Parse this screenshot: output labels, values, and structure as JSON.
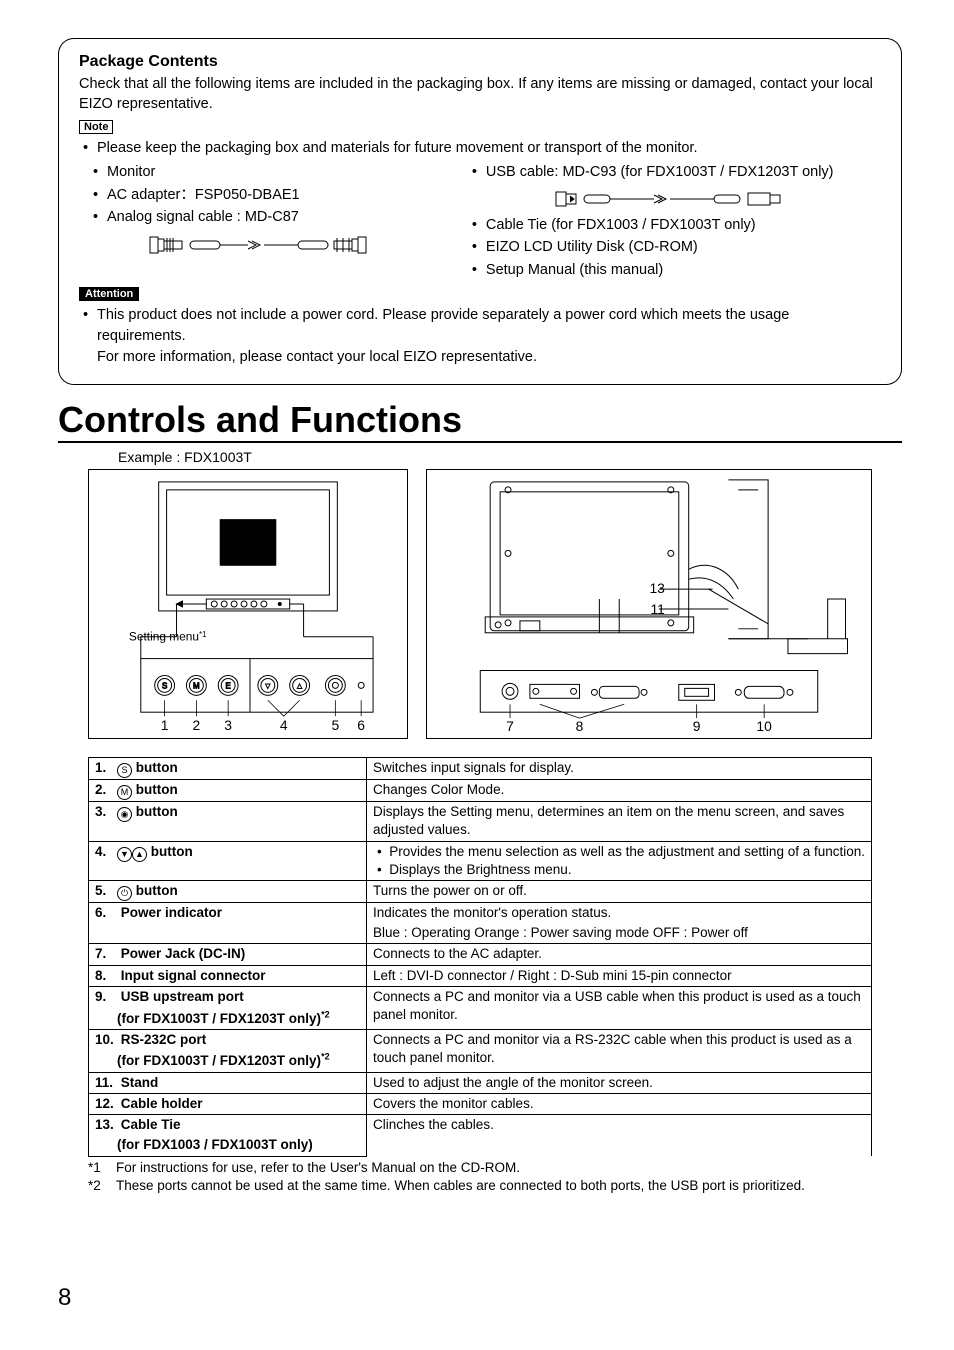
{
  "pkg": {
    "title": "Package Contents",
    "intro": "Check that all the following items are included in the packaging box. If any items are missing or damaged, contact your local EIZO representative.",
    "noteLabel": "Note",
    "noteLine": "Please keep the packaging box and materials for future movement or transport of the monitor.",
    "leftItems": [
      "Monitor",
      "AC adapter：FSP050-DBAE1",
      "Analog signal cable : MD-C87"
    ],
    "rightItems": [
      "USB cable: MD-C93 (for FDX1003T / FDX1203T only)",
      "Cable Tie (for FDX1003 / FDX1003T only)",
      "EIZO LCD Utility Disk (CD-ROM)",
      "Setup Manual (this manual)"
    ],
    "attLabel": "Attention",
    "att1": "This product does not include a power cord. Please provide separately a power cord which meets the usage requirements.",
    "att2": "For more information, please contact your local EIZO representative."
  },
  "sectTitle": "Controls and Functions",
  "example": "Example : FDX1003T",
  "settingMenu": "Setting menu",
  "settingSup": "*1",
  "figNums": {
    "left": [
      "1",
      "2",
      "3",
      "4",
      "5",
      "6"
    ],
    "right": [
      "7",
      "8",
      "9",
      "10"
    ],
    "side": [
      "13",
      "11"
    ]
  },
  "table": [
    {
      "n": "1.",
      "icon": "S",
      "label": " button",
      "desc": "Switches input signals for display."
    },
    {
      "n": "2.",
      "icon": "M",
      "label": " button",
      "desc": "Changes Color Mode."
    },
    {
      "n": "3.",
      "icon": "E",
      "label": " button",
      "desc": "Displays the Setting menu, determines an item on the menu screen, and saves adjusted values."
    },
    {
      "n": "4.",
      "icon": "VA",
      "label": " button",
      "desc": "• Provides the menu selection as well as the adjustment and setting of a function.\n• Displays the Brightness menu."
    },
    {
      "n": "5.",
      "icon": "P",
      "label": " button",
      "desc": "Turns the power on or off."
    },
    {
      "n": "6.",
      "label": "Power indicator",
      "desc": "Indicates the monitor's operation status.\nBlue : Operating    Orange : Power saving mode    OFF : Power off"
    },
    {
      "n": "7.",
      "label": "Power Jack (DC-IN)",
      "desc": "Connects to the AC adapter."
    },
    {
      "n": "8.",
      "label": "Input signal connector",
      "desc": "Left : DVI-D connector / Right : D-Sub mini 15-pin connector"
    },
    {
      "n": "9.",
      "label": "USB upstream port",
      "sub": "(for FDX1003T / FDX1203T only)*2",
      "desc": "Connects a PC and monitor via a USB cable when this product is used as a touch panel monitor."
    },
    {
      "n": "10.",
      "label": "RS-232C port",
      "sub": "(for FDX1003T / FDX1203T only)*2",
      "desc": "Connects a PC and monitor via a RS-232C cable when this product is used as a touch panel monitor."
    },
    {
      "n": "11.",
      "label": "Stand",
      "desc": "Used to adjust the angle of the monitor screen."
    },
    {
      "n": "12.",
      "label": "Cable holder",
      "desc": "Covers the monitor cables."
    },
    {
      "n": "13.",
      "label": "Cable Tie",
      "sub": "(for FDX1003 / FDX1003T only)",
      "desc": "Clinches the cables."
    }
  ],
  "footnotes": {
    "f1m": "*1",
    "f1": "For instructions for use, refer to the User's Manual on the CD-ROM.",
    "f2m": "*2",
    "f2": "These ports cannot be used at the same time. When cables are connected to both ports, the USB port is prioritized."
  },
  "pageNo": "8"
}
